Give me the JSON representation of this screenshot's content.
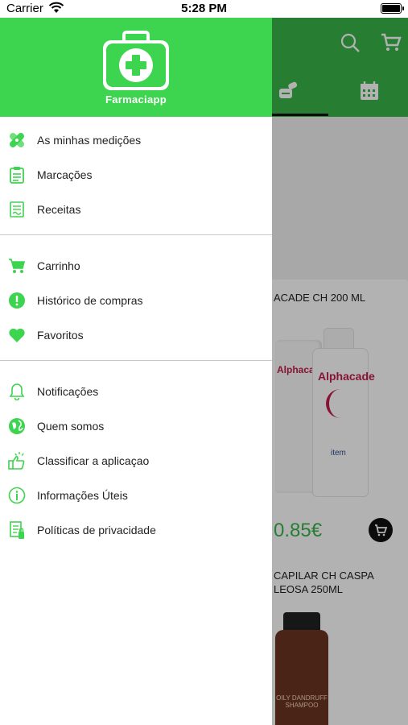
{
  "status_bar": {
    "carrier": "Carrier",
    "time": "5:28 PM"
  },
  "drawer": {
    "app_name": "Farmaciapp",
    "groups": [
      [
        {
          "label": "As minhas medições",
          "icon": "bandage-icon"
        },
        {
          "label": "Marcações",
          "icon": "clipboard-icon"
        },
        {
          "label": "Receitas",
          "icon": "prescription-icon"
        }
      ],
      [
        {
          "label": "Carrinho",
          "icon": "cart-icon"
        },
        {
          "label": "Histórico de compras",
          "icon": "alert-circle-icon"
        },
        {
          "label": "Favoritos",
          "icon": "heart-icon"
        }
      ],
      [
        {
          "label": "Notificações",
          "icon": "bell-icon"
        },
        {
          "label": "Quem somos",
          "icon": "globe-icon"
        },
        {
          "label": "Classificar a aplicaçao",
          "icon": "thumbs-up-icon"
        },
        {
          "label": "Informações Úteis",
          "icon": "info-icon"
        },
        {
          "label": "Políticas de privacidade",
          "icon": "document-icon"
        }
      ]
    ]
  },
  "background": {
    "products": [
      {
        "title": "ACADE CH 200 ML",
        "price": "0.85€",
        "brand_text": "Alphacade",
        "brand_sub": "item"
      },
      {
        "title": "CAPILAR CH CASPA\nLEOSA 250ML",
        "label_text": "OILY DANDRUFF\nSHAMPOO"
      }
    ]
  },
  "colors": {
    "drawer_header": "#3dd44f",
    "app_header": "#39b54a",
    "accent": "#39b54a",
    "icon_green": "#3dd44f"
  }
}
